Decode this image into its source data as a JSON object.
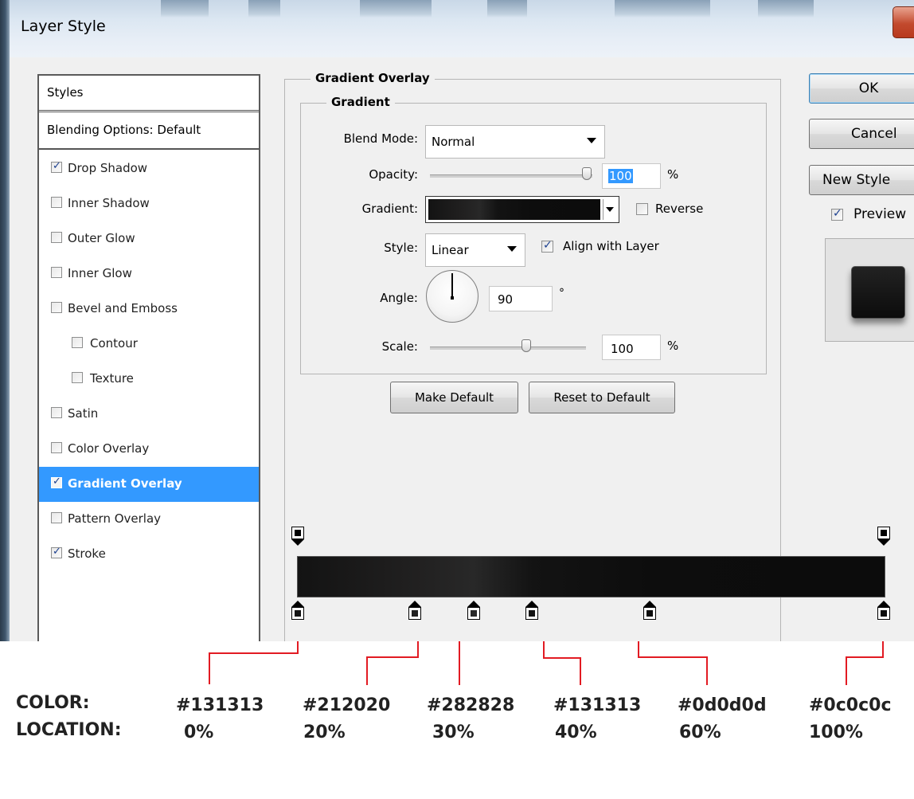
{
  "window": {
    "title": "Layer Style"
  },
  "styles_panel": {
    "header": "Styles",
    "blending_options": "Blending Options: Default",
    "items": [
      {
        "label": "Drop Shadow",
        "checked": true
      },
      {
        "label": "Inner Shadow",
        "checked": false
      },
      {
        "label": "Outer Glow",
        "checked": false
      },
      {
        "label": "Inner Glow",
        "checked": false
      },
      {
        "label": "Bevel and Emboss",
        "checked": false
      },
      {
        "label": "Contour",
        "checked": false
      },
      {
        "label": "Texture",
        "checked": false
      },
      {
        "label": "Satin",
        "checked": false
      },
      {
        "label": "Color Overlay",
        "checked": false
      },
      {
        "label": "Gradient Overlay",
        "checked": true,
        "selected": true
      },
      {
        "label": "Pattern Overlay",
        "checked": false
      },
      {
        "label": "Stroke",
        "checked": true
      }
    ]
  },
  "gradient_overlay": {
    "title": "Gradient Overlay",
    "group_title": "Gradient",
    "blend_mode": {
      "label": "Blend Mode:",
      "value": "Normal"
    },
    "opacity": {
      "label": "Opacity:",
      "value": "100",
      "unit": "%",
      "level": 1.0
    },
    "gradient": {
      "label": "Gradient:",
      "reverse_label": "Reverse",
      "reverse_checked": false
    },
    "style": {
      "label": "Style:",
      "value": "Linear",
      "align_label": "Align with Layer",
      "align_checked": true
    },
    "angle": {
      "label": "Angle:",
      "value": "90",
      "unit": "°"
    },
    "scale": {
      "label": "Scale:",
      "value": "100",
      "unit": "%",
      "level": 0.5
    },
    "make_default": "Make Default",
    "reset_default": "Reset to Default"
  },
  "right_panel": {
    "ok": "OK",
    "cancel": "Cancel",
    "new_style": "New Style",
    "preview_label": "Preview",
    "preview_checked": true
  },
  "gradient_stops": [
    {
      "color": "#131313",
      "location": "0%"
    },
    {
      "color": "#212020",
      "location": "20%"
    },
    {
      "color": "#282828",
      "location": "30%"
    },
    {
      "color": "#131313",
      "location": "40%"
    },
    {
      "color": "#0d0d0d",
      "location": "60%"
    },
    {
      "color": "#0c0c0c",
      "location": "100%"
    }
  ],
  "annotation": {
    "color_label": "COLOR:",
    "location_label": "LOCATION:",
    "entries": [
      {
        "color": "#131313",
        "location": "0%"
      },
      {
        "color": "#212020",
        "location": "20%"
      },
      {
        "color": "#282828",
        "location": "30%"
      },
      {
        "color": "#131313",
        "location": "40%"
      },
      {
        "color": "#0d0d0d",
        "location": "60%"
      },
      {
        "color": "#0c0c0c",
        "location": "100%"
      }
    ]
  },
  "accent_colors": {
    "selection": "#3399ff",
    "annotation_line": "#e21b23"
  }
}
